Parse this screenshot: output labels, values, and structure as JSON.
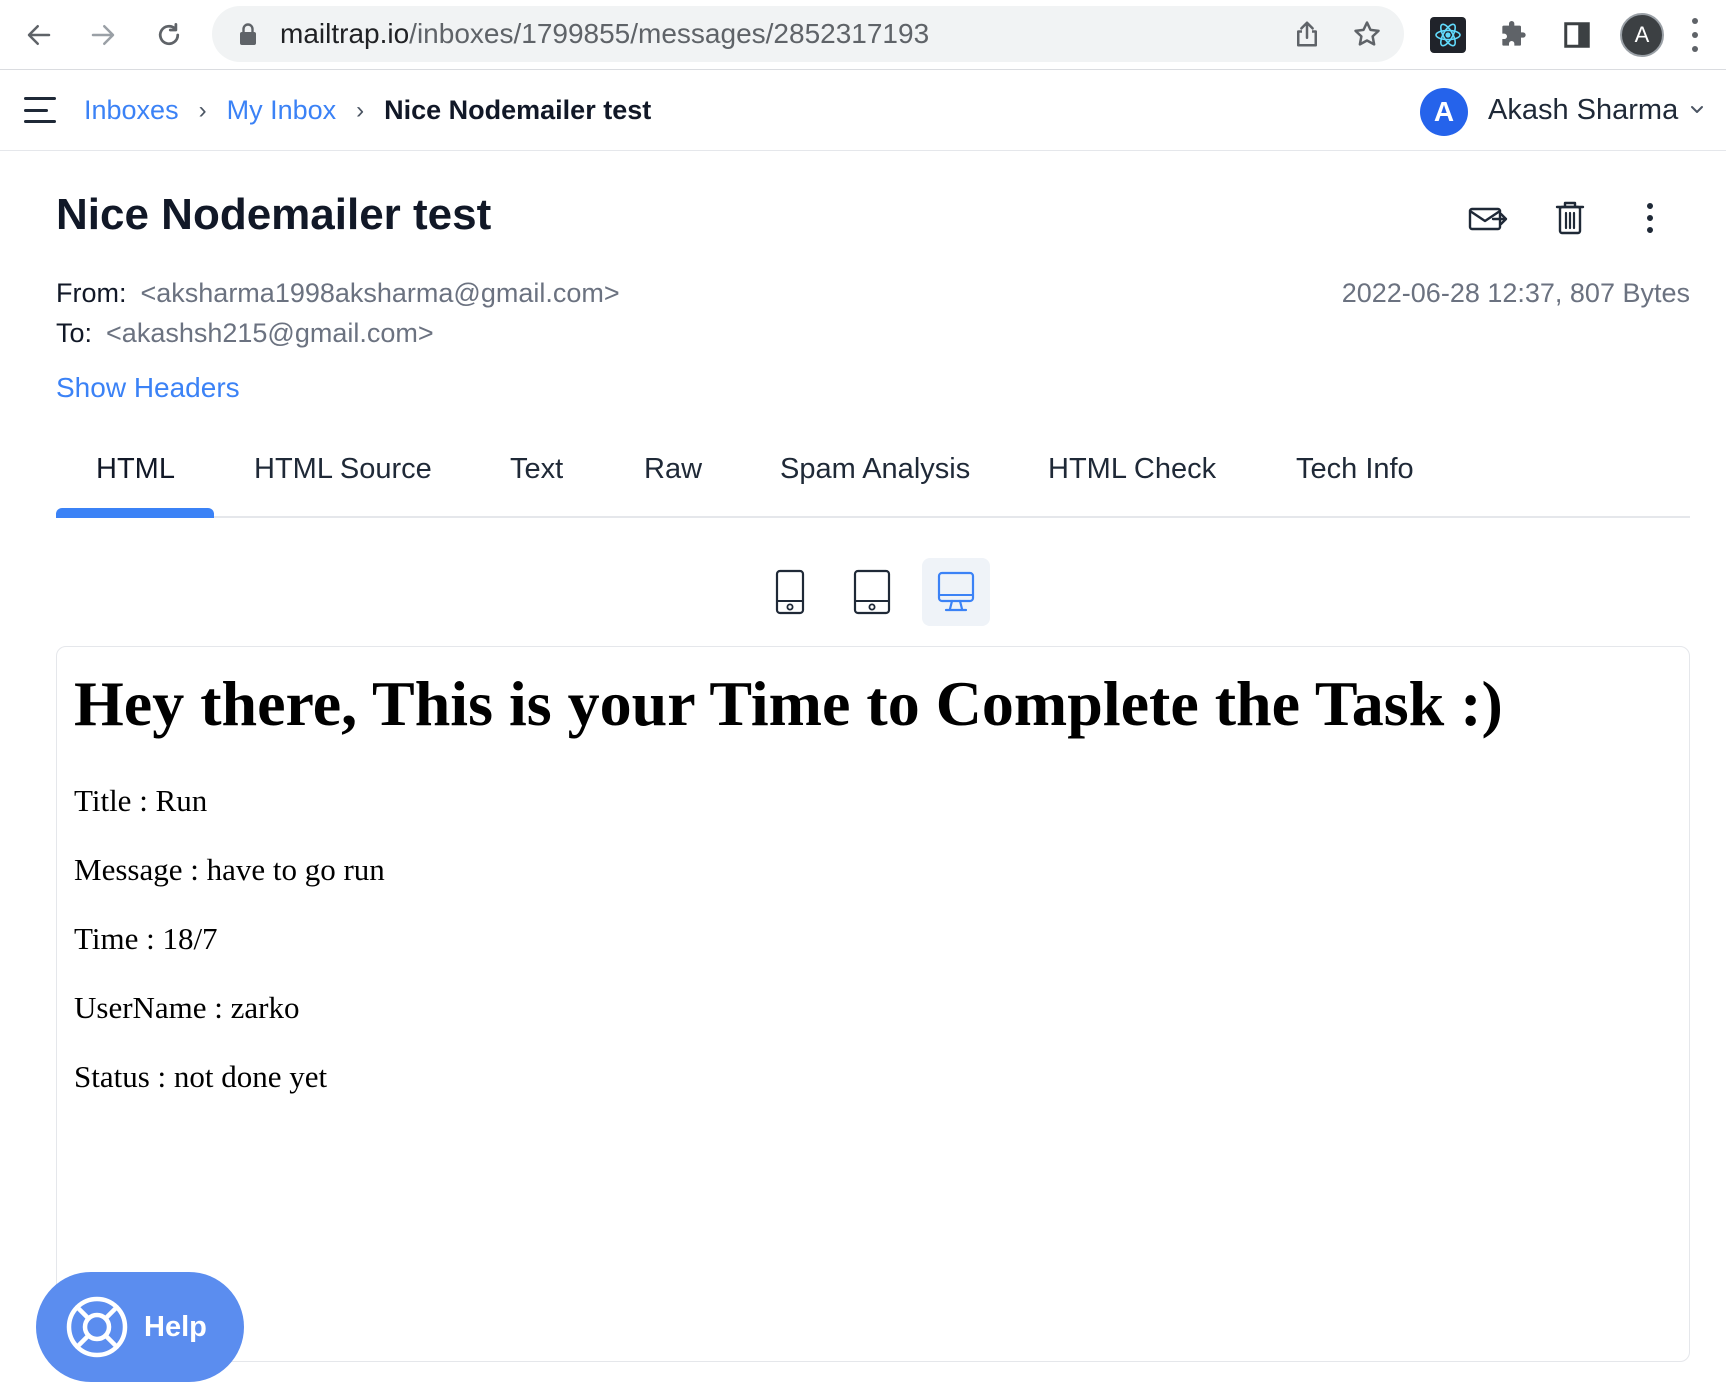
{
  "browser": {
    "url_host": "mailtrap.io",
    "url_path": "/inboxes/1799855/messages/2852317193",
    "profile_initial": "A",
    "icons": [
      "back-icon",
      "forward-icon",
      "reload-icon",
      "lock-icon",
      "share-icon",
      "bookmark-star-icon",
      "react-devtools-icon",
      "extensions-puzzle-icon",
      "side-panel-icon",
      "menu-kebab-icon"
    ]
  },
  "header": {
    "breadcrumb": [
      "Inboxes",
      "My Inbox",
      "Nice Nodemailer test"
    ],
    "breadcrumb_separator": "›",
    "user_initial": "A",
    "user_name": "Akash Sharma",
    "accent_color": "#3b82f6"
  },
  "message": {
    "subject": "Nice Nodemailer test",
    "from_label": "From:",
    "from_value": "<aksharma1998aksharma@gmail.com>",
    "to_label": "To:",
    "to_value": "<akashsh215@gmail.com>",
    "date_size": "2022-06-28 12:37, 807 Bytes",
    "show_headers": "Show Headers",
    "actions": [
      "forward-email-icon",
      "delete-trash-icon",
      "more-kebab-icon"
    ]
  },
  "tabs": [
    "HTML",
    "HTML Source",
    "Text",
    "Raw",
    "Spam Analysis",
    "HTML Check",
    "Tech Info"
  ],
  "active_tab": "HTML",
  "devices": {
    "options": [
      "mobile-icon",
      "tablet-icon",
      "desktop-icon"
    ],
    "active": "desktop-icon"
  },
  "email_body": {
    "heading": "Hey there, This is your Time to Complete the Task :)",
    "lines": [
      "Title : Run",
      "Message : have to go run",
      "Time : 18/7",
      "UserName : zarko",
      "Status : not done yet"
    ]
  },
  "help": {
    "label": "Help",
    "color": "#5b8def"
  }
}
